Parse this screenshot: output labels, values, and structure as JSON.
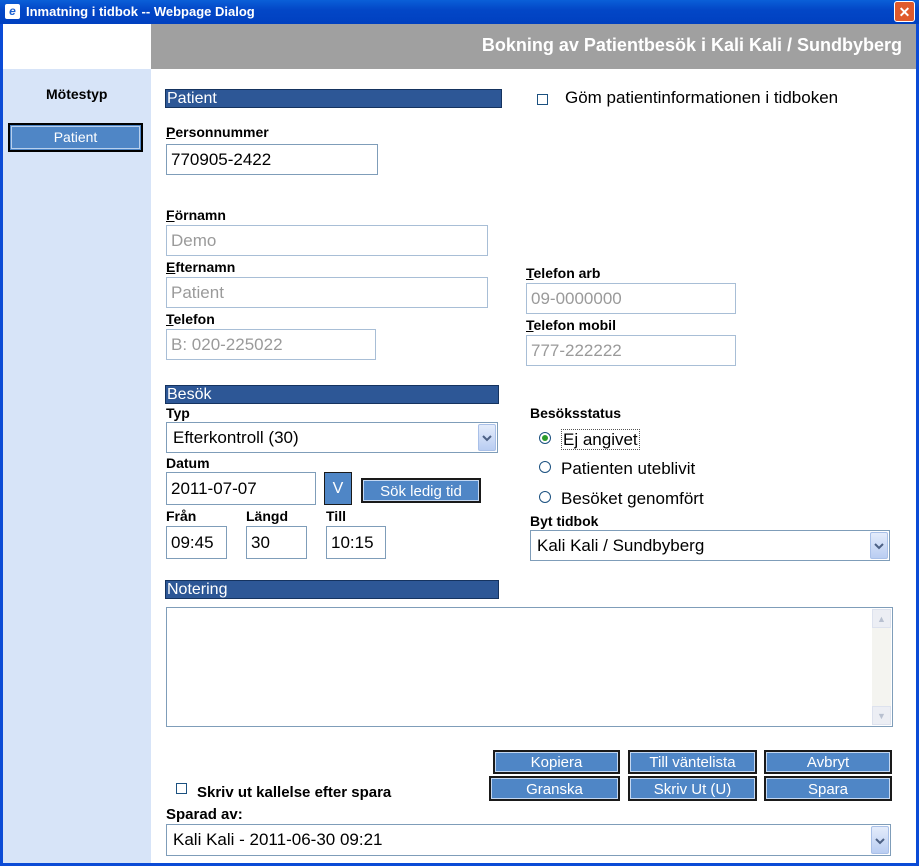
{
  "window": {
    "title": "Inmatning i tidbok -- Webpage Dialog",
    "close_glyph": "✕",
    "ie_glyph": "e"
  },
  "header": {
    "title": "Bokning av Patientbesök  i Kali Kali / Sundbyberg"
  },
  "sidebar": {
    "heading": "Mötestyp",
    "patient_button": "Patient"
  },
  "patient": {
    "section_title": "Patient",
    "hide_checkbox_label": "Göm patientinformationen i tidboken",
    "personnummer_label_u": "P",
    "personnummer_label_rest": "ersonnummer",
    "personnummer_value": "770905-2422",
    "fornamn_label_u": "F",
    "fornamn_label_rest": "örnamn",
    "fornamn_value": "Demo",
    "efternamn_label_u": "E",
    "efternamn_label_rest": "fternamn",
    "efternamn_value": "Patient",
    "telefon_label_u": "T",
    "telefon_label_rest": "elefon",
    "telefon_value": "B: 020-225022",
    "telefon_arb_label_u": "T",
    "telefon_arb_label_rest": "elefon arb",
    "telefon_arb_value": "09-0000000",
    "telefon_mobil_label_u": "T",
    "telefon_mobil_label_rest": "elefon mobil",
    "telefon_mobil_value": "777-222222"
  },
  "visit": {
    "section_title": "Besök",
    "typ_label": "Typ",
    "typ_value": "Efterkontroll (30)",
    "datum_label": "Datum",
    "datum_value": "2011-07-07",
    "v_button": "V",
    "search_button": "Sök ledig tid",
    "fran_label": "Från",
    "fran_value": "09:45",
    "langd_label": "Längd",
    "langd_value": "30",
    "till_label": "Till",
    "till_value": "10:15",
    "status_label": "Besöksstatus",
    "status_options": [
      "Ej angivet",
      "Patienten uteblivit",
      "Besöket genomfört"
    ],
    "status_selected": "Ej angivet",
    "byt_tidbok_label": "Byt tidbok",
    "byt_tidbok_value": "Kali Kali / Sundbyberg"
  },
  "notes": {
    "section_title": "Notering",
    "value": ""
  },
  "actions": {
    "kopiera": "Kopiera",
    "till_vantelista": "Till väntelista",
    "avbryt": "Avbryt",
    "granska": "Granska",
    "skriv_ut": "Skriv Ut (U)",
    "spara": "Spara",
    "print_checkbox_label": "Skriv ut kallelse efter spara",
    "sparad_av_label": "Sparad av:",
    "sparad_av_value": "Kali Kali - 2011-06-30 09:21"
  },
  "colors": {
    "titlebar": "#0347c7",
    "header_bg": "#a0a0a0",
    "sidebar_bg": "#d7e4f8",
    "section_bar": "#2d5796",
    "button_bg": "#4f86c6"
  }
}
